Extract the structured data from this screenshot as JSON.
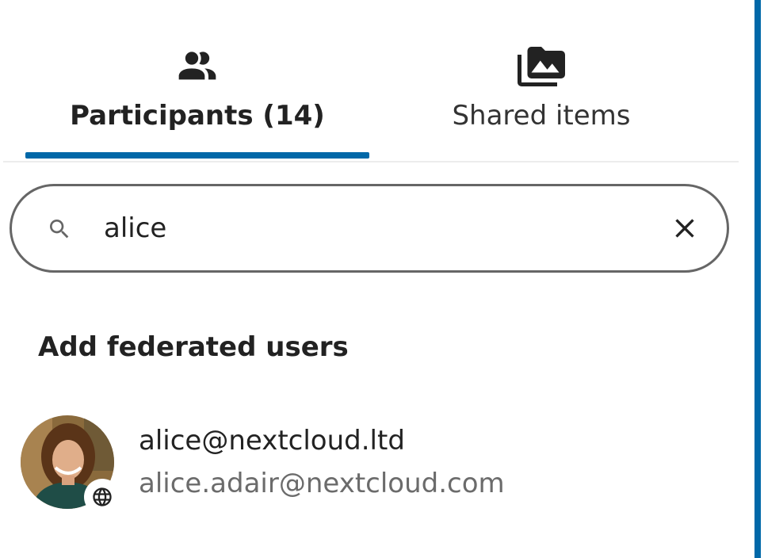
{
  "tabs": {
    "participants": {
      "label": "Participants (14)",
      "icon": "account-group-icon",
      "active": true
    },
    "shared_items": {
      "label": "Shared items",
      "icon": "folder-multiple-image-icon",
      "active": false
    }
  },
  "search": {
    "value": "alice",
    "icon": "magnify-icon",
    "clear_icon": "close-icon"
  },
  "federated": {
    "heading": "Add federated users",
    "users": [
      {
        "name": "alice@nextcloud.ltd",
        "subtitle": "alice.adair@nextcloud.com",
        "badge_icon": "web-icon"
      }
    ]
  },
  "colors": {
    "accent": "#0068a8",
    "text": "#222222",
    "muted_text": "#6b6b6b",
    "border": "#666666"
  }
}
